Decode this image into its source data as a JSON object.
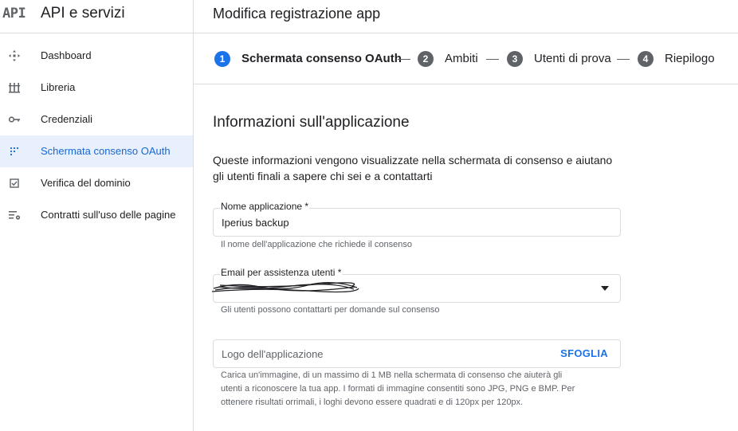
{
  "sidebar": {
    "logo": "API",
    "title": "API e servizi",
    "items": [
      {
        "label": "Dashboard",
        "icon": "dashboard-icon"
      },
      {
        "label": "Libreria",
        "icon": "library-icon"
      },
      {
        "label": "Credenziali",
        "icon": "key-icon"
      },
      {
        "label": "Schermata consenso OAuth",
        "icon": "oauth-consent-icon",
        "active": true
      },
      {
        "label": "Verifica del dominio",
        "icon": "domain-verification-icon"
      },
      {
        "label": "Contratti sull'uso delle pagine",
        "icon": "page-usage-settings-icon"
      }
    ]
  },
  "main": {
    "title": "Modifica registrazione app",
    "steps": [
      {
        "num": "1",
        "label": "Schermata consenso OAuth",
        "active": true
      },
      {
        "num": "2",
        "label": "Ambiti"
      },
      {
        "num": "3",
        "label": "Utenti di prova"
      },
      {
        "num": "4",
        "label": "Riepilogo"
      }
    ],
    "section": {
      "title": "Informazioni sull'applicazione",
      "description": "Queste informazioni vengono visualizzate nella schermata di consenso e aiutano gli utenti finali a sapere chi sei e a contattarti"
    },
    "form": {
      "app_name": {
        "label": "Nome applicazione *",
        "value": "Iperius backup",
        "hint": "Il nome dell'applicazione che richiede il consenso"
      },
      "support_email": {
        "label": "Email per assistenza utenti *",
        "value": "",
        "hint": "Gli utenti possono contattarti per domande sul consenso"
      },
      "logo": {
        "placeholder": "Logo dell'applicazione",
        "browse_label": "SFOGLIA",
        "hint_lines": [
          "Carica un'immagine, di un massimo di 1 MB nella schermata di consenso che aiuterà gli",
          "utenti a riconoscere la tua app. I formati di immagine consentiti sono JPG, PNG e BMP. Per",
          "ottenere risultati orrimali, i loghi devono essere quadrati e di 120px per 120px."
        ]
      }
    }
  },
  "colors": {
    "accent": "#1a73e8",
    "active_bg": "#e8f0fe",
    "active_text": "#1967d2",
    "step_inactive": "#5f6368",
    "border": "#dadce0"
  }
}
